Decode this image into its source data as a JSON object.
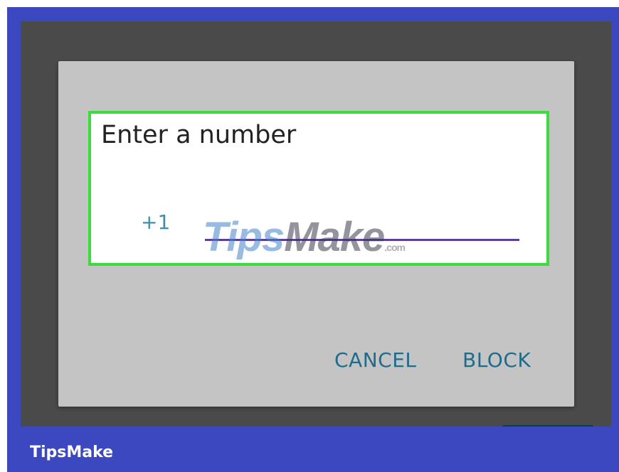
{
  "dialog": {
    "title": "Enter a number",
    "country_code": "+1",
    "number_value": "",
    "cancel_label": "CANCEL",
    "block_label": "BLOCK"
  },
  "fab": {
    "icon": "plus-icon",
    "glyph": "+"
  },
  "watermark": {
    "text_tips": "Tips",
    "text_make": "Make",
    "text_dotcom": ".com"
  },
  "footer": {
    "brand": "TipsMake"
  },
  "colors": {
    "frame_border": "#3b48c0",
    "highlight": "#3ddc3d",
    "dialog_bg": "#c4c4c4",
    "button_text": "#1f6b8c",
    "underline": "#5b3f9a",
    "country_code": "#3f8fa8"
  }
}
